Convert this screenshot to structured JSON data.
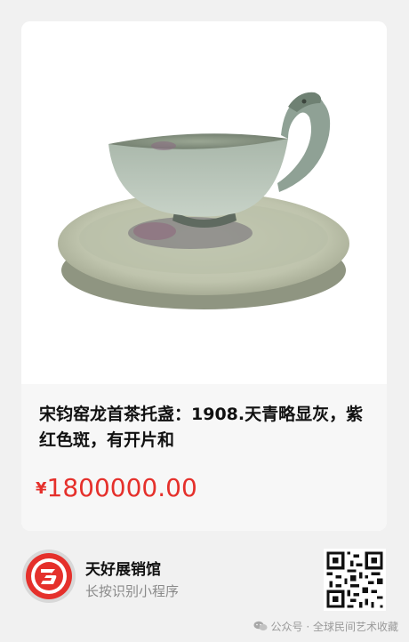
{
  "product": {
    "title": "宋钧窑龙首茶托盏：1908.天青略显灰，紫红色斑，有开片和",
    "currency_symbol": "¥",
    "price": "1800000.00",
    "price_color": "#e5302b"
  },
  "miniprogram": {
    "name": "天好展销馆",
    "hint": "长按识别小程序",
    "logo_color": "#e5302b"
  },
  "watermark": {
    "text": "公众号 · 全球民间艺术收藏"
  }
}
